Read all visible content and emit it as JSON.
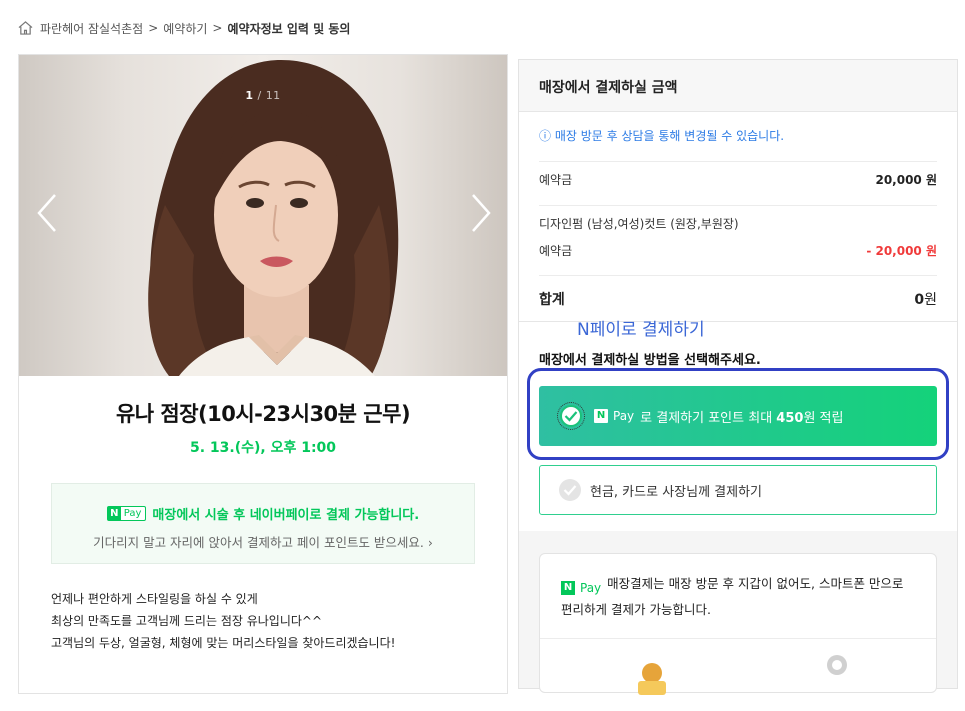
{
  "breadcrumb": {
    "items": [
      "파란헤어 잠실석촌점",
      "예약하기",
      "예약자정보 입력 및 동의"
    ],
    "separator": ">"
  },
  "gallery": {
    "current": "1",
    "total": "11",
    "divider": "/"
  },
  "stylist": {
    "name": "유나 점장(10시-23시30분 근무)",
    "datetime": "5. 13.(수), 오후 1:00"
  },
  "npay_banner": {
    "badge_n": "N",
    "badge_pay": "Pay",
    "headline": "매장에서 시술 후 네이버페이로 결제 가능합니다.",
    "subtext": "기다리지 말고 자리에 앉아서 결제하고 페이 포인트도 받으세요.",
    "chevron": "›"
  },
  "intro": {
    "lines": [
      "언제나 편안하게 스타일링을 하실 수 있게",
      "최상의 만족도를 고객님께 드리는 점장 유나입니다^^",
      "고객님의 두상, 얼굴형, 체형에 맞는 머리스타일을 찾아드리겠습니다!"
    ]
  },
  "payment": {
    "header": "매장에서 결제하실 금액",
    "notice": "ⓘ 매장 방문 후 상담을 통해 변경될 수 있습니다.",
    "rows": [
      {
        "label": "예약금",
        "value": "20,000 원"
      },
      {
        "label": "디자인펌 (남성,여성)컷트 (원장,부원장)"
      },
      {
        "label": "예약금",
        "value": "- 20,000 원"
      }
    ],
    "total_label": "합계",
    "total_value": "0",
    "total_unit": "원",
    "npay_link": "N페이로 결제하기",
    "method_title": "매장에서 결제하실 방법을 선택해주세요.",
    "option_npay": {
      "badge_n": "N",
      "badge_pay": "Pay",
      "text_pre": "로 결제하기 포인트 최대 ",
      "text_bold": "450",
      "text_post": "원 적립",
      "selected": true
    },
    "option_cash": {
      "label": "현금, 카드로 사장님께 결제하기",
      "selected": false
    },
    "info": {
      "badge_n": "N",
      "badge_pay": "Pay",
      "text": "매장결제는 매장 방문 후 지갑이 없어도, 스마트폰 만으로 편리하게 결제가 가능합니다."
    },
    "colors": {
      "accent_green": "#03c75a",
      "negative_red": "#f03a3a",
      "notice_blue": "#2c7be5",
      "highlight_border": "#3140c4"
    }
  }
}
